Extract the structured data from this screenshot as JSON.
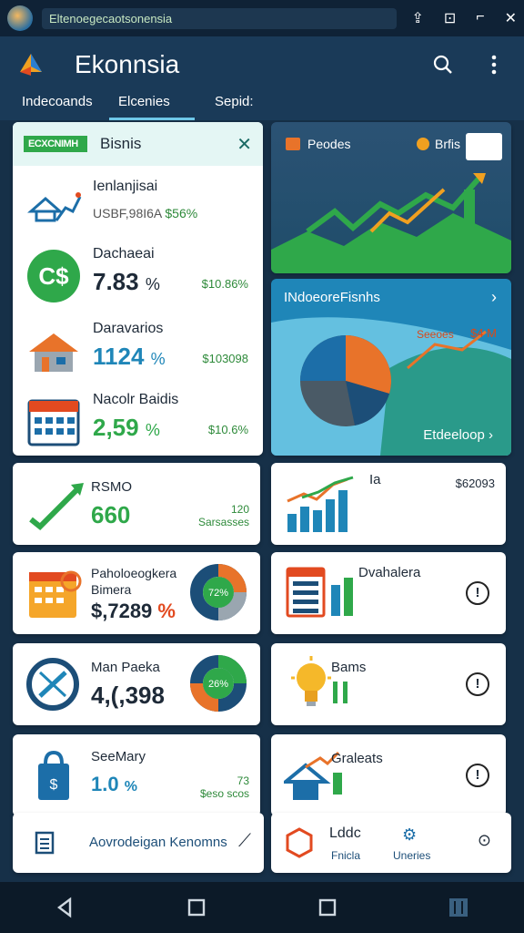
{
  "status": {
    "text": "Eltenoegecaotsonensia",
    "icons": [
      "share-icon",
      "download-icon",
      "crop-icon",
      "close-icon"
    ]
  },
  "appbar": {
    "title": "Ekonnsia",
    "icons": [
      "search-icon",
      "more-vert-icon"
    ]
  },
  "tabs": [
    {
      "label": "Indecoands"
    },
    {
      "label": "Elcenies"
    },
    {
      "label": "Sepid:"
    }
  ],
  "left_panel": {
    "header_logo": "ECXCNIMH",
    "header_title": "Bisnis",
    "rows": [
      {
        "label": "Ienlanjisai",
        "value": "USBF,98I6A",
        "value_accent": "$56%",
        "side": ""
      },
      {
        "label": "Dachaeai",
        "value": "7.83",
        "unit": "%",
        "side": "$10.86%"
      },
      {
        "label": "Daravarios",
        "value": "1124",
        "unit": "%",
        "side": "$103098"
      },
      {
        "label": "Nacolr Baidis",
        "value": "2,59",
        "unit": "%",
        "side": "$10.6%"
      }
    ]
  },
  "right_top": {
    "label_left": "Peodes",
    "label_right": "Brfis"
  },
  "right_pie": {
    "title": "INdoeoreFisnhs",
    "series_a": "Seeoes",
    "series_b": "$4 M",
    "footer": "Etdeeloop"
  },
  "tiles": [
    {
      "label": "RSMO",
      "value": "660",
      "note_top": "120",
      "note": "Sarsasses"
    },
    {
      "label": "Ia",
      "value": "",
      "note_top": "",
      "note": "$62093"
    },
    {
      "label": "Paholoeogkera Bimera",
      "value": "$,7289",
      "unit": "%",
      "donut_text": "72%"
    },
    {
      "label": "Dvahalera",
      "value": ""
    },
    {
      "label": "Man Paeka",
      "value": "4,(,398",
      "donut_text": "26%"
    },
    {
      "label": "Bams",
      "value": ""
    },
    {
      "label": "SeeMary",
      "value": "1.0",
      "unit": "%",
      "note_top": "73",
      "note": "$eso scos"
    },
    {
      "label": "Graleats",
      "value": ""
    }
  ],
  "bottom_left": {
    "label": "Aovrodeigan Kenomns"
  },
  "bottom_right": {
    "label1": "Lddc",
    "sub1": "Fnicla",
    "sub2": "Uneries"
  },
  "colors": {
    "navy": "#1a3a58",
    "green": "#2fa84a",
    "blue": "#1f86b8",
    "orange": "#e8732a"
  }
}
